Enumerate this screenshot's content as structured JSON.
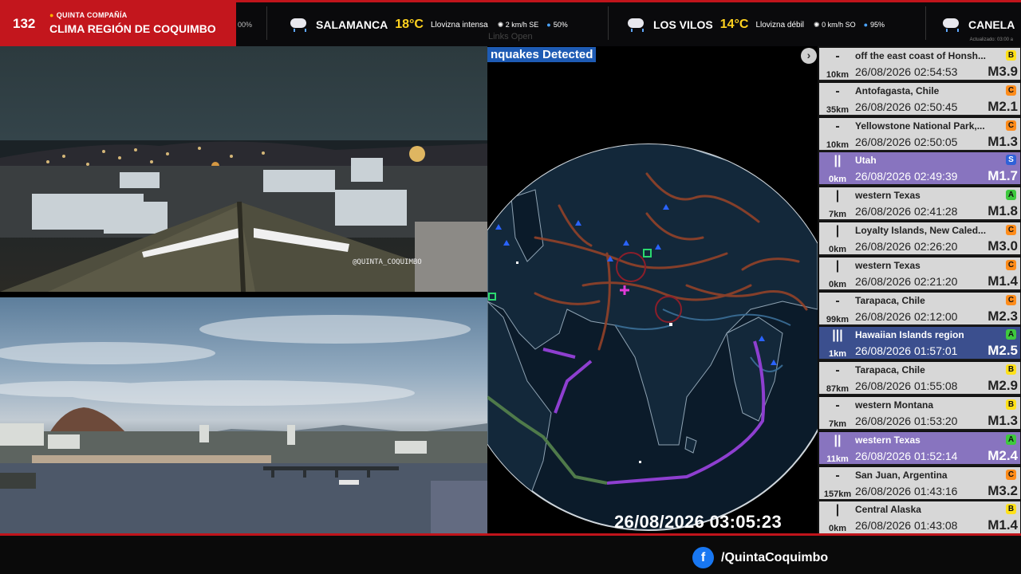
{
  "brand": {
    "number": "132",
    "company": "QUINTA COMPAÑÍA",
    "title": "CLIMA REGIÓN DE COQUIMBO"
  },
  "ticker": {
    "fragment": "00%",
    "items": [
      {
        "icon": "rain-cloud-icon",
        "city": "SALAMANCA",
        "temp": "18°C",
        "condition": "Llovizna intensa",
        "wind": "2 km/h SE",
        "humidity": "50%"
      },
      {
        "icon": "rain-cloud-icon",
        "city": "LOS VILOS",
        "temp": "14°C",
        "condition": "Llovizna débil",
        "wind": "0 km/h SO",
        "humidity": "95%"
      },
      {
        "icon": "rain-cloud-icon",
        "city": "CANELA"
      }
    ],
    "updated": "Actualizado: 03:00 a"
  },
  "cams": {
    "cam1_watermark": "@QUINTA_COQUIMBO"
  },
  "map": {
    "badge": "nquakes Detected",
    "open_links": "Links  Open",
    "close_icon": "chevron-right-icon",
    "clock": "26/08/2026 03:05:23",
    "colors": {
      "plates": "#8a3a2a",
      "trench": "#8e3fd0",
      "ocean": "#0b1b2a"
    }
  },
  "quakes": [
    {
      "bars": "-",
      "dist": "10km",
      "place": "off the east coast of Honsh...",
      "time": "26/08/2026 02:54:53",
      "mag": "M3.9",
      "level": "B",
      "level_color": "#ffe11a",
      "style": "grey"
    },
    {
      "bars": "-",
      "dist": "35km",
      "place": "Antofagasta, Chile",
      "time": "26/08/2026 02:50:45",
      "mag": "M2.1",
      "level": "C",
      "level_color": "#ff8c1a",
      "style": "grey"
    },
    {
      "bars": "-",
      "dist": "10km",
      "place": "Yellowstone National Park,...",
      "time": "26/08/2026 02:50:05",
      "mag": "M1.3",
      "level": "C",
      "level_color": "#ff8c1a",
      "style": "grey"
    },
    {
      "bars": "||",
      "dist": "0km",
      "place": "Utah",
      "time": "26/08/2026 02:49:39",
      "mag": "M1.7",
      "level": "S",
      "level_color": "#2f61d8",
      "style": "purple"
    },
    {
      "bars": "|",
      "dist": "7km",
      "place": "western Texas",
      "time": "26/08/2026 02:41:28",
      "mag": "M1.8",
      "level": "A",
      "level_color": "#3ec93e",
      "style": "grey"
    },
    {
      "bars": "|",
      "dist": "0km",
      "place": "Loyalty Islands, New Caled...",
      "time": "26/08/2026 02:26:20",
      "mag": "M3.0",
      "level": "C",
      "level_color": "#ff8c1a",
      "style": "grey"
    },
    {
      "bars": "|",
      "dist": "0km",
      "place": "western Texas",
      "time": "26/08/2026 02:21:20",
      "mag": "M1.4",
      "level": "C",
      "level_color": "#ff8c1a",
      "style": "grey"
    },
    {
      "bars": "-",
      "dist": "99km",
      "place": "Tarapaca, Chile",
      "time": "26/08/2026 02:12:00",
      "mag": "M2.3",
      "level": "C",
      "level_color": "#ff8c1a",
      "style": "grey"
    },
    {
      "bars": "|||",
      "dist": "1km",
      "place": "Hawaiian Islands region",
      "time": "26/08/2026 01:57:01",
      "mag": "M2.5",
      "level": "A",
      "level_color": "#3ec93e",
      "style": "navy"
    },
    {
      "bars": "-",
      "dist": "87km",
      "place": "Tarapaca, Chile",
      "time": "26/08/2026 01:55:08",
      "mag": "M2.9",
      "level": "B",
      "level_color": "#ffe11a",
      "style": "grey"
    },
    {
      "bars": "-",
      "dist": "7km",
      "place": "western Montana",
      "time": "26/08/2026 01:53:20",
      "mag": "M1.3",
      "level": "B",
      "level_color": "#ffe11a",
      "style": "grey"
    },
    {
      "bars": "||",
      "dist": "11km",
      "place": "western Texas",
      "time": "26/08/2026 01:52:14",
      "mag": "M2.4",
      "level": "A",
      "level_color": "#3ec93e",
      "style": "purple"
    },
    {
      "bars": "-",
      "dist": "157km",
      "place": "San Juan, Argentina",
      "time": "26/08/2026 01:43:16",
      "mag": "M3.2",
      "level": "C",
      "level_color": "#ff8c1a",
      "style": "grey"
    },
    {
      "bars": "|",
      "dist": "0km",
      "place": "Central Alaska",
      "time": "26/08/2026 01:43:08",
      "mag": "M1.4",
      "level": "B",
      "level_color": "#ffe11a",
      "style": "grey"
    }
  ],
  "footer": {
    "fb_icon": "facebook-icon",
    "fb_letter": "f",
    "handle": "/QuintaCoquimbo"
  }
}
